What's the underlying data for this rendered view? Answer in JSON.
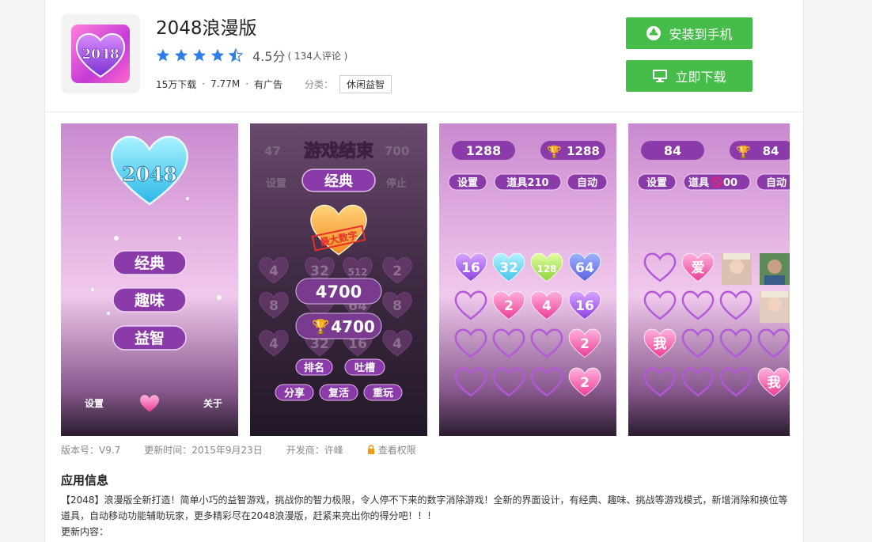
{
  "app": {
    "title": "2048浪漫版",
    "icon_text": "2048",
    "rating": 4.5,
    "score_text": "4.5分",
    "review_count": "( 134人评论 )",
    "downloads": "15万下载",
    "size": "7.77M",
    "ads": "有广告",
    "category_label": "分类：",
    "category": "休闲益智"
  },
  "actions": {
    "install_label": "安装到手机",
    "download_label": "立即下载"
  },
  "screenshots": {
    "s1": {
      "heart": "2048",
      "menu": [
        "经典",
        "趣味",
        "益智"
      ],
      "settings": "设置",
      "about": "关于"
    },
    "s2": {
      "title": "游戏结束",
      "mode": "经典",
      "settings": "设置",
      "stop": "停止",
      "stamp": "最大数字",
      "score": "4700",
      "best": "4700",
      "top_left": "47",
      "top_right": "700",
      "rank": "排名",
      "roast": "吐槽",
      "share": "分享",
      "revive": "复活",
      "replay": "重玩",
      "grid": [
        "4",
        "32",
        "512",
        "2",
        "8",
        "",
        "64",
        "8",
        "4",
        "32",
        "16",
        "4"
      ]
    },
    "s3": {
      "score": "1288",
      "best": "1288",
      "settings": "设置",
      "props": "道具210",
      "auto": "自动",
      "grid": [
        "16",
        "32",
        "128",
        "64",
        "",
        "2",
        "4",
        "16",
        "",
        "",
        "",
        "2",
        "",
        "",
        "",
        "2"
      ]
    },
    "s4": {
      "score": "84",
      "best": "84",
      "settings": "设置",
      "props": "道具",
      "props_num": "00",
      "auto": "自动",
      "grid": [
        "",
        "爱",
        "",
        "",
        "",
        "",
        "",
        "",
        "我",
        "",
        "",
        "",
        "",
        "",
        "",
        "我"
      ]
    }
  },
  "info": {
    "version": "版本号：V9.7",
    "update_time": "更新时间：2015年9月23日",
    "developer": "开发商：许峰",
    "permission": "查看权限"
  },
  "description": {
    "section_title": "应用信息",
    "text": "【2048】浪漫版全新打造！简单小巧的益智游戏，挑战你的智力极限，令人停不下来的数字消除游戏！全新的界面设计，有经典、趣味、挑战等游戏模式，新增消除和换位等道具，自动移动功能辅助玩家，更多精彩尽在2048浪漫版，赶紧来亮出你的得分吧！！！",
    "update_label": "更新内容："
  },
  "colors": {
    "accent_green": "#46bd4a",
    "star_blue": "#2f7ee8"
  }
}
